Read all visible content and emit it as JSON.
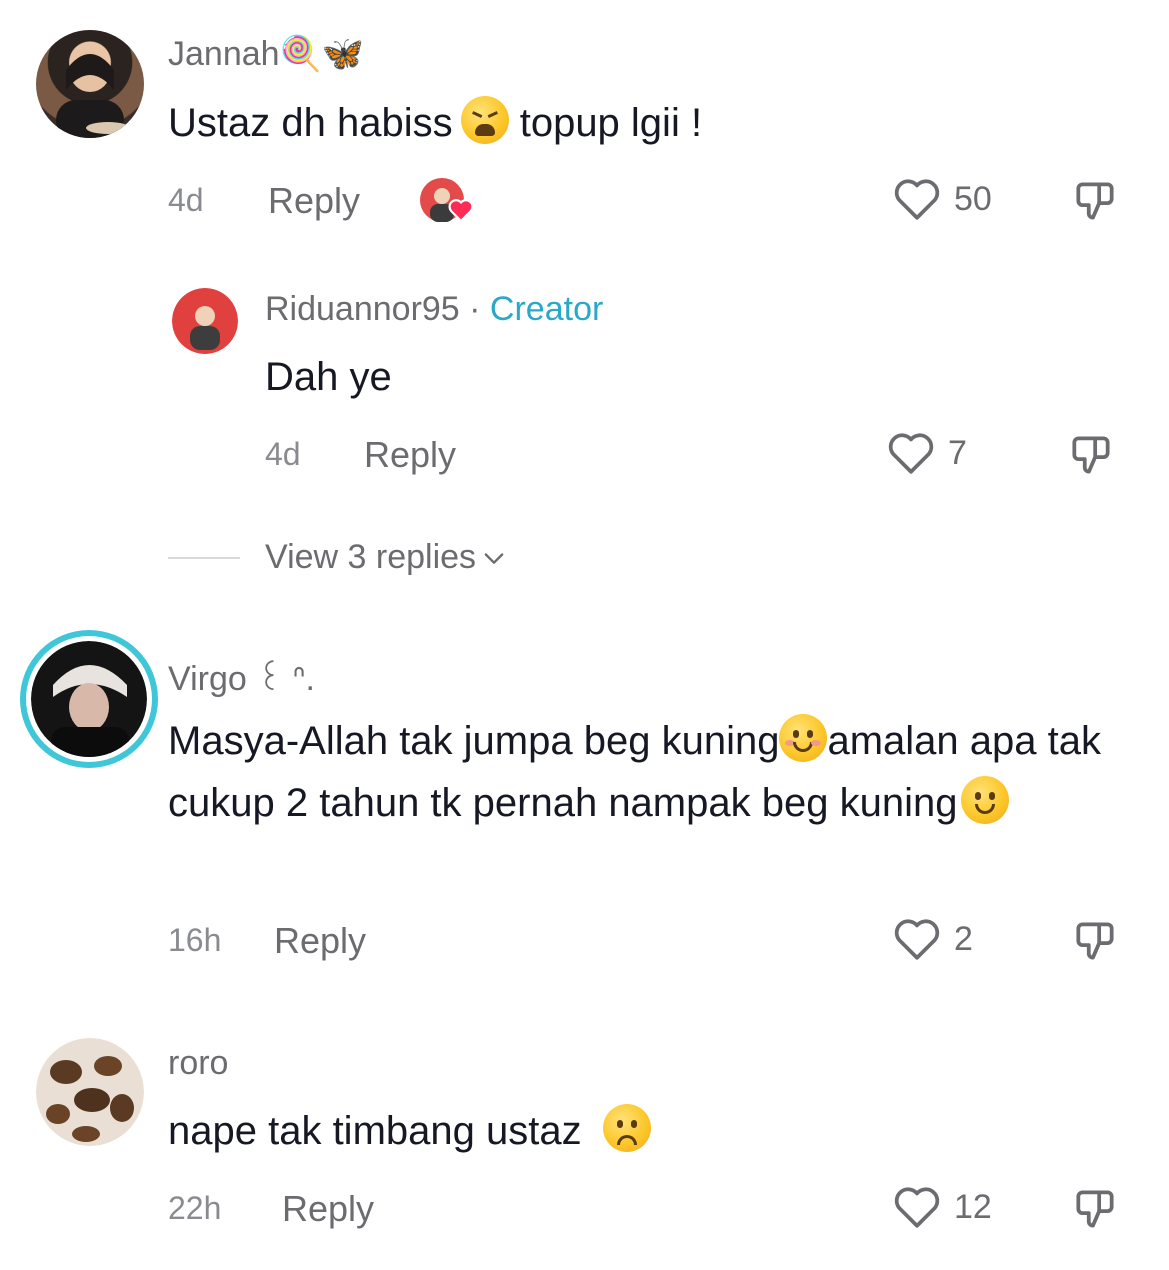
{
  "comments": [
    {
      "username": "Jannah",
      "username_emoji": "🍭🦋",
      "text_before": "Ustaz dh habiss",
      "text_after": " topup lgii !",
      "time": "4d",
      "reply_label": "Reply",
      "likes": "50",
      "creator_liked": true
    },
    {
      "username": "Riduannor95",
      "separator": " · ",
      "badge": "Creator",
      "text": "Dah ye",
      "time": "4d",
      "reply_label": "Reply",
      "likes": "7"
    },
    {
      "username": "Virgo ꒰ ᐢ.",
      "text_before": "Masya-Allah tak jumpa beg kuning",
      "text_middle": "amalan apa tak cukup 2 tahun tk pernah nampak beg kuning",
      "time": "16h",
      "reply_label": "Reply",
      "likes": "2"
    },
    {
      "username": "roro",
      "text_before": "nape tak timbang ustaz ",
      "time": "22h",
      "reply_label": "Reply",
      "likes": "12"
    }
  ],
  "view_replies_label": "View 3 replies",
  "colors": {
    "creator": "#2aa8c8",
    "text": "#161823",
    "secondary": "#6b6b70",
    "story_ring": "#3fc6d8"
  },
  "icons": [
    "heart-outline-icon",
    "dislike-icon",
    "chevron-down-icon"
  ]
}
